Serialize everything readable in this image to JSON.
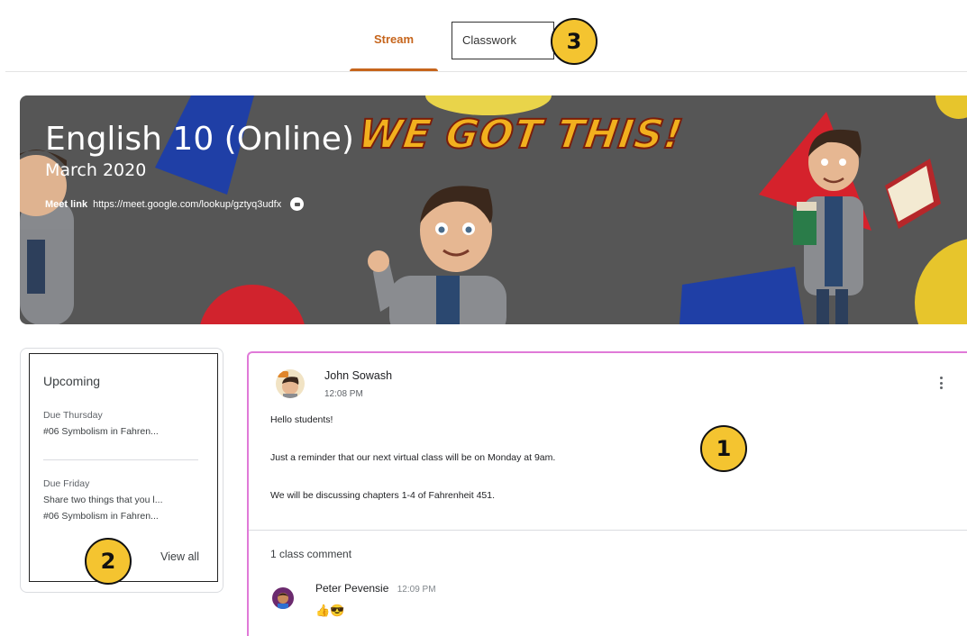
{
  "tabs": {
    "stream_label": "Stream",
    "classwork_label": "Classwork"
  },
  "callouts": {
    "one": "1",
    "two": "2",
    "three": "3"
  },
  "banner": {
    "title": "English 10 (Online)",
    "subtitle": "March 2020",
    "meet_label": "Meet link",
    "meet_url": "https://meet.google.com/lookup/gztyq3udfx",
    "artwork_text": "WE GOT THIS!"
  },
  "upcoming": {
    "title": "Upcoming",
    "groups": [
      {
        "due": "Due Thursday",
        "items": [
          "#06 Symbolism in Fahren..."
        ]
      },
      {
        "due": "Due Friday",
        "items": [
          "Share two things that you l...",
          "#06 Symbolism in Fahren..."
        ]
      }
    ],
    "view_all_label": "View all"
  },
  "post": {
    "author": "John Sowash",
    "time": "12:08 PM",
    "lines": [
      "Hello students!",
      "Just a reminder that our next virtual class will be on Monday at 9am.",
      "We will be discussing chapters 1-4 of Fahrenheit 451."
    ],
    "comment_count_label": "1 class comment",
    "comment": {
      "author": "Peter Pevensie",
      "time": "12:09 PM",
      "text": "👍😎"
    }
  },
  "colors": {
    "accent": "#c6651c",
    "callout_fill": "#f4c430",
    "highlight_border": "#e07ad8",
    "banner_bg": "#565656"
  },
  "icons": [
    "meet-chat-icon",
    "more-vert-icon",
    "avatar-john-sowash",
    "avatar-peter-pevensie"
  ]
}
